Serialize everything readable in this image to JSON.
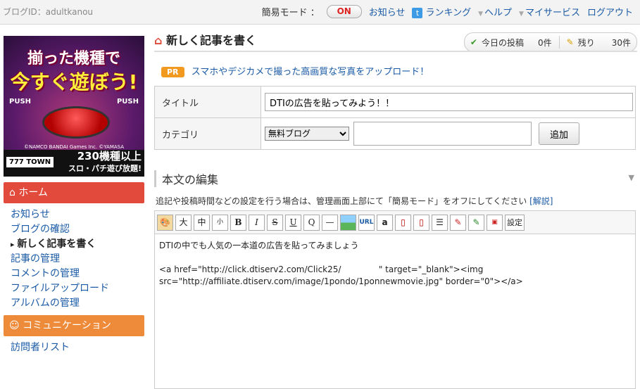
{
  "topbar": {
    "blog_id": "ブログID：adultkanou",
    "mode_label": "簡易モード ：",
    "mode_toggle": "ON",
    "links": [
      {
        "label": "お知らせ"
      },
      {
        "label": "ランキング"
      },
      {
        "label": "ヘルプ"
      },
      {
        "label": "マイサービス"
      },
      {
        "label": "ログアウト"
      }
    ]
  },
  "banner": {
    "line1": "揃った機種で",
    "line2": "今すぐ遊ぼう!",
    "push_left": "PUSH",
    "push_right": "PUSH",
    "copyright": "©NAMCO BANDAI Games Inc. ©YAMASA",
    "brand": "777 TOWN",
    "count_line1": "230機種以上",
    "count_line2": "スロ・パチ遊び放題!"
  },
  "sidebar": {
    "home_title": "ホーム",
    "home_items": [
      {
        "label": "お知らせ"
      },
      {
        "label": "ブログの確認"
      },
      {
        "label": "新しく記事を書く"
      },
      {
        "label": "記事の管理"
      },
      {
        "label": "コメントの管理"
      },
      {
        "label": "ファイルアップロード"
      },
      {
        "label": "アルバムの管理"
      }
    ],
    "comm_title": "コミュニケーション",
    "comm_items": [
      {
        "label": "訪問者リスト"
      }
    ]
  },
  "main": {
    "page_title": "新しく記事を書く",
    "stats": {
      "today_label": "今日の投稿",
      "today_value": "0件",
      "remain_label": "残り",
      "remain_value": "30件"
    },
    "pr_badge": "PR",
    "pr_text": "スマホやデジカメで撮った高画質な写真をアップロード！",
    "form": {
      "title_label": "タイトル",
      "title_value": "DTIの広告を貼ってみよう！！",
      "category_label": "カテゴリ",
      "category_selected": "無料ブログ",
      "add_button": "追加"
    },
    "body_section_title": "本文の編集",
    "note": "追記や投稿時間などの設定を行う場合は、管理画面上部にて「簡易モード」をオフにしてください",
    "note_link": "[解説]",
    "toolbar": {
      "buttons": [
        "大",
        "中",
        "小",
        "B",
        "I",
        "S",
        "U",
        "Q",
        "—",
        "URL",
        "設定"
      ]
    },
    "editor_text": "DTIの中でも人気の一本道の広告を貼ってみましょう\n\n<a href=\"http://click.dtiserv2.com/Click25/              \" target=\"_blank\"><img src=\"http://affiliate.dtiserv.com/image/1pondo/1ponnewmovie.jpg\" border=\"0\"></a>"
  },
  "colors": {
    "home_header": "#e24a3c",
    "comm_header": "#ee8b3a",
    "link": "#1a5aa6",
    "pr_badge": "#f29a1f"
  }
}
